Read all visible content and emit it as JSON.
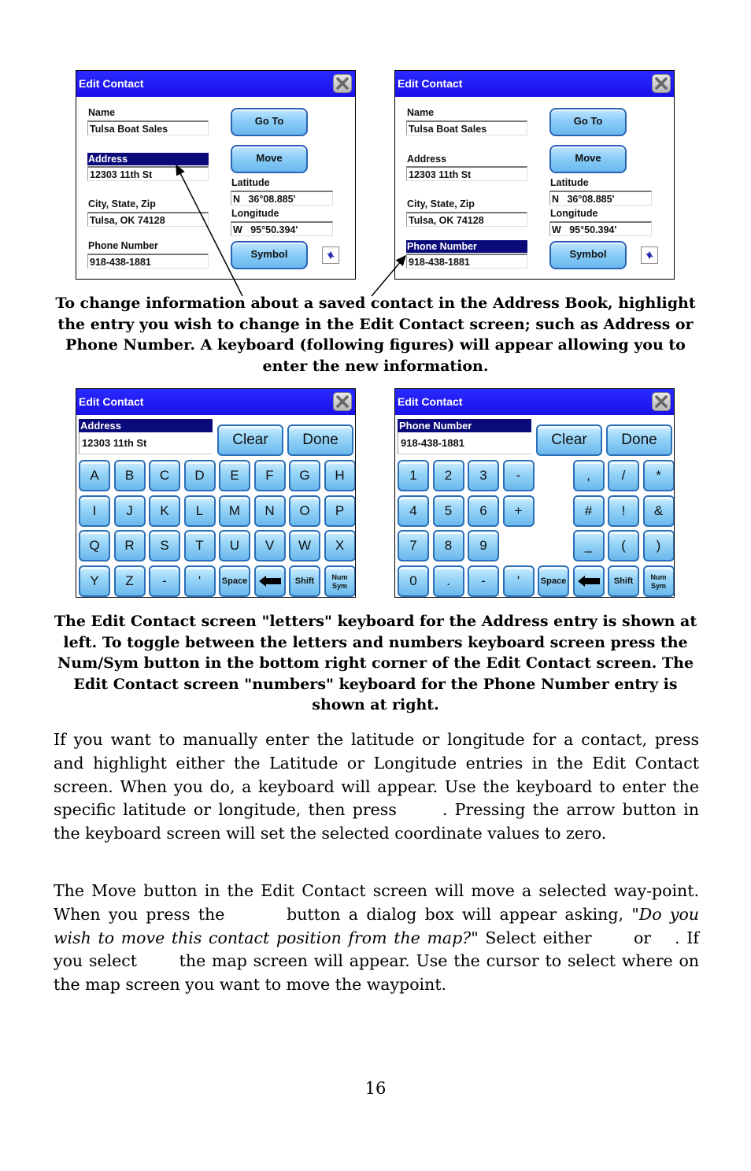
{
  "edit_contact_screens": [
    {
      "title": "Edit Contact",
      "highlighted_field": "address",
      "fields": {
        "name_label": "Name",
        "name_value": "Tulsa Boat Sales",
        "address_label": "Address",
        "address_value": "12303 11th St",
        "city_label": "City, State, Zip",
        "city_value": "Tulsa, OK 74128",
        "phone_label": "Phone Number",
        "phone_value": "918-438-1881",
        "latitude_label": "Latitude",
        "latitude_value": "N   36°08.885'",
        "longitude_label": "Longitude",
        "longitude_value": "W   95°50.394'"
      },
      "buttons": {
        "goto": "Go To",
        "move": "Move",
        "symbol": "Symbol"
      }
    },
    {
      "title": "Edit Contact",
      "highlighted_field": "phone",
      "fields": {
        "name_label": "Name",
        "name_value": "Tulsa Boat Sales",
        "address_label": "Address",
        "address_value": "12303 11th St",
        "city_label": "City, State, Zip",
        "city_value": "Tulsa, OK 74128",
        "phone_label": "Phone Number",
        "phone_value": "918-438-1881",
        "latitude_label": "Latitude",
        "latitude_value": "N   36°08.885'",
        "longitude_label": "Longitude",
        "longitude_value": "W   95°50.394'"
      },
      "buttons": {
        "goto": "Go To",
        "move": "Move",
        "symbol": "Symbol"
      }
    }
  ],
  "keyboard_screens": [
    {
      "title": "Edit Contact",
      "entry_label": "Address",
      "entry_value": "12303 11th St",
      "clear": "Clear",
      "done": "Done",
      "rows": [
        [
          "A",
          "B",
          "C",
          "D",
          "E",
          "F",
          "G",
          "H"
        ],
        [
          "I",
          "J",
          "K",
          "L",
          "M",
          "N",
          "O",
          "P"
        ],
        [
          "Q",
          "R",
          "S",
          "T",
          "U",
          "V",
          "W",
          "X"
        ],
        [
          "Y",
          "Z",
          "-",
          "'",
          "Space",
          "backspace",
          "Shift",
          "Num Sym"
        ]
      ]
    },
    {
      "title": "Edit Contact",
      "entry_label": "Phone Number",
      "entry_value": "918-438-1881",
      "clear": "Clear",
      "done": "Done",
      "rows": [
        [
          "1",
          "2",
          "3",
          "-",
          "",
          ",",
          "/",
          "*"
        ],
        [
          "4",
          "5",
          "6",
          "+",
          "",
          "#",
          "!",
          "&"
        ],
        [
          "7",
          "8",
          "9",
          "",
          "",
          "_",
          "(",
          ")"
        ],
        [
          "0",
          ".",
          "-",
          "'",
          "Space",
          "backspace",
          "Shift",
          "Num Sym"
        ]
      ]
    }
  ],
  "captions": {
    "first": "To change information about a saved contact in the Address Book, highlight the entry you wish to change in the Edit Contact screen; such as Address or Phone Number. A keyboard (following figures) will appear allowing you to enter the new information.",
    "second": "The Edit Contact screen \"letters\" keyboard for the Address entry is shown at left. To toggle between the letters and numbers keyboard screen press the Num/Sym button in the bottom right corner of the Edit Contact screen. The Edit Contact screen \"numbers\" keyboard for the Phone Number entry is shown at right."
  },
  "paragraphs": {
    "p1_a": "If you want to manually enter the latitude or longitude for a contact, press and highlight either the Latitude or Longitude entries in the Edit Contact screen. When you do, a keyboard will appear. Use the keyboard to enter the specific latitude or longitude, then press",
    "p1_b": ". Pressing the arrow button in the keyboard screen will set the selected coordinate values to zero.",
    "p2_a": "The Move button in the Edit Contact screen will move a selected way-point. When you press the",
    "p2_b": "button a dialog box will appear asking,",
    "p2_quote": "\"Do you wish to move this contact position from the map?\"",
    "p2_c": "Select either",
    "p2_d": "or",
    "p2_e": ". If you select",
    "p2_f": "the map screen will appear. Use the cursor to select where on the map screen you want to move the waypoint."
  },
  "page_number": "16"
}
